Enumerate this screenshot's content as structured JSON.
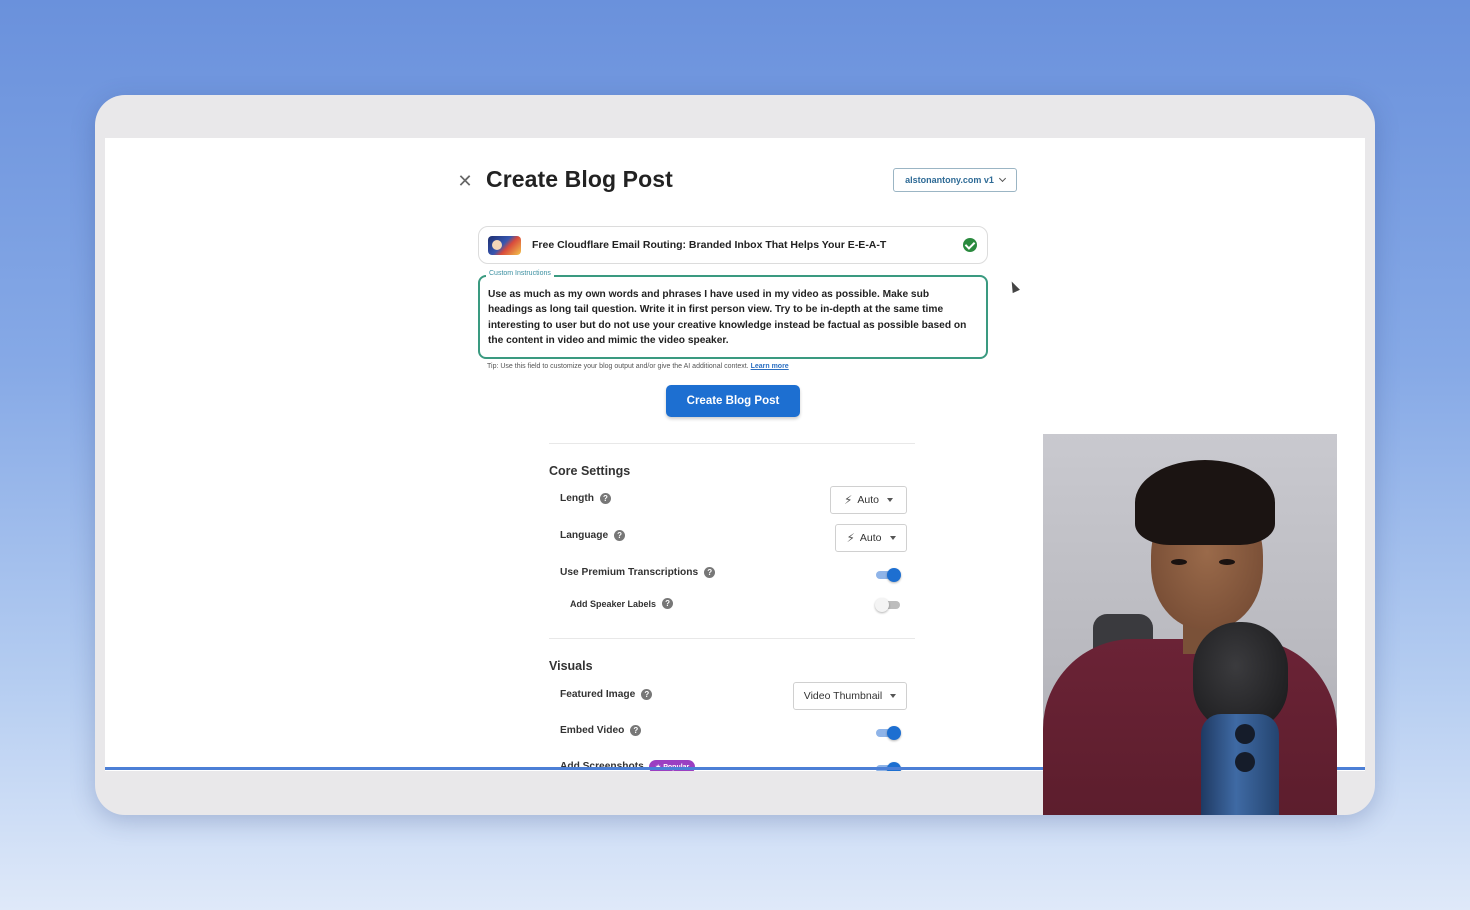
{
  "header": {
    "title": "Create Blog Post",
    "close_icon": "close-icon",
    "site_selector": "alstonantony.com v1"
  },
  "video": {
    "title": "Free Cloudflare Email Routing: Branded Inbox That Helps Your E-E-A-T",
    "status_icon": "check-circle-icon"
  },
  "custom_instructions": {
    "label": "Custom Instructions",
    "value": "Use as much as my own words and phrases I have used in my video as possible. Make sub headings as long tail question. Write it in first person view. Try to be in-depth at the same time interesting to user but do not use your creative knowledge instead be factual as possible based on the content in video and mimic the video speaker.",
    "tip": "Tip: Use this field to customize your blog output and/or give the AI additional context.",
    "learn_more": "Learn more"
  },
  "create_button": "Create Blog Post",
  "core_settings": {
    "title": "Core Settings",
    "length": {
      "label": "Length",
      "value": "Auto"
    },
    "language": {
      "label": "Language",
      "value": "Auto"
    },
    "premium_transcriptions": {
      "label": "Use Premium Transcriptions",
      "on": true
    },
    "speaker_labels": {
      "label": "Add Speaker Labels",
      "on": false
    }
  },
  "visuals": {
    "title": "Visuals",
    "featured_image": {
      "label": "Featured Image",
      "value": "Video Thumbnail"
    },
    "embed_video": {
      "label": "Embed Video",
      "on": true
    },
    "add_screenshots": {
      "label": "Add Screenshots",
      "badge": "★ Popular",
      "on": true
    }
  },
  "colors": {
    "primary": "#1d6fd1",
    "accent_teal": "#3a9a80",
    "badge_purple": "#9b3fc2"
  }
}
